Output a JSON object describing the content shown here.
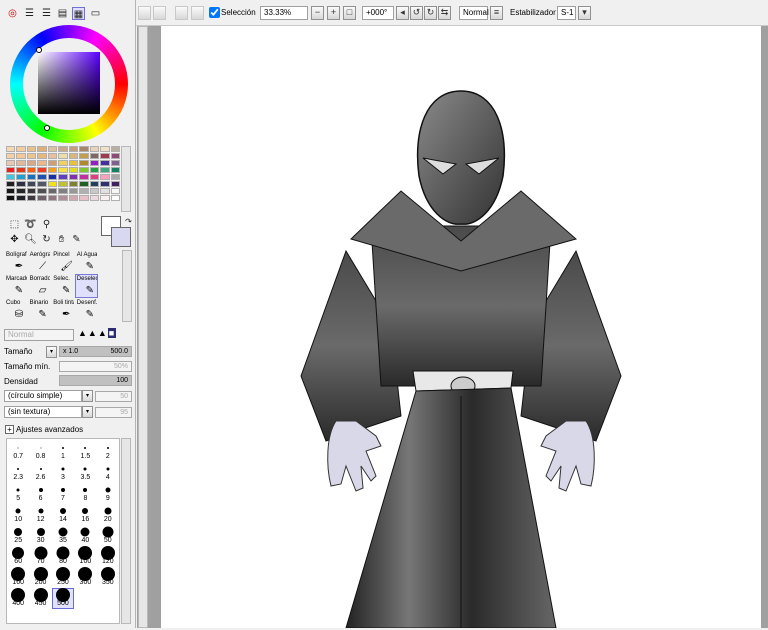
{
  "toolbar": {
    "selection_label": "Selección",
    "zoom": "33.33%",
    "rotation": "+000°",
    "blend_mode": "Normal",
    "stabilizer_label": "Estabilizador",
    "stabilizer_value": "S-1"
  },
  "color": {
    "hue_marker": "#5b00ff",
    "primary": "#ffffff",
    "secondary": "#d8d8f0"
  },
  "palette": [
    "#f6d8b4",
    "#f0cca0",
    "#e8c08c",
    "#dcb078",
    "#d8c0a0",
    "#c8a888",
    "#c0a080",
    "#a88868",
    "#e8d4b8",
    "#f0e0c8",
    "#b8b0a0",
    "#f4d0a8",
    "#f4c898",
    "#ecc48c",
    "#e4b880",
    "#e8c0a0",
    "#e8e0a8",
    "#d8b878",
    "#c0a050",
    "#806860",
    "#a03850",
    "#904878",
    "#e8c8b0",
    "#e0b8a0",
    "#d8a888",
    "#e8b890",
    "#d0a070",
    "#f0d060",
    "#e8c040",
    "#b08830",
    "#9020c0",
    "#4030a0",
    "#806090",
    "#e82020",
    "#e03818",
    "#f86010",
    "#e84028",
    "#f4a020",
    "#f8e040",
    "#e0e020",
    "#80c830",
    "#20a040",
    "#40a880",
    "#108060",
    "#40c8e0",
    "#20a0d0",
    "#1870c0",
    "#2050b0",
    "#1830a0",
    "#6040c0",
    "#8030b0",
    "#c030a0",
    "#e04080",
    "#f8a0c0",
    "#a8a8a8",
    "#202020",
    "#303040",
    "#404858",
    "#505868",
    "#f0e020",
    "#c0c030",
    "#808030",
    "#206020",
    "#204060",
    "#303070",
    "#402060",
    "#181818",
    "#282828",
    "#383838",
    "#505050",
    "#686868",
    "#808080",
    "#989898",
    "#b0b0b0",
    "#c8c8c8",
    "#e0e0e0",
    "#f8f8f8",
    "#101010",
    "#202028",
    "#403840",
    "#706068",
    "#907880",
    "#b09098",
    "#d0a8b0",
    "#e8c0c8",
    "#f0d8e0",
    "#f8f0f0",
    "#ffffff"
  ],
  "brushes": [
    {
      "label": "Bolígrafo",
      "icon": "pen-icon"
    },
    {
      "label": "Aerógrafo",
      "icon": "airbrush-icon"
    },
    {
      "label": "Pincel",
      "icon": "brush-icon"
    },
    {
      "label": "Al Agua",
      "icon": "water-brush-icon"
    },
    {
      "label": "",
      "icon": ""
    },
    {
      "label": "Marcador",
      "icon": "marker-icon"
    },
    {
      "label": "Borrador",
      "icon": "eraser-icon"
    },
    {
      "label": "Selec.",
      "icon": "select-pen-icon"
    },
    {
      "label": "Deselec.",
      "icon": "deselect-pen-icon"
    },
    {
      "label": "",
      "icon": ""
    },
    {
      "label": "Cubo",
      "icon": "bucket-icon"
    },
    {
      "label": "Binario",
      "icon": "binary-icon"
    },
    {
      "label": "Boli tinta",
      "icon": "ink-pen-icon"
    },
    {
      "label": "Desenf.",
      "icon": "blur-icon"
    },
    {
      "label": "",
      "icon": ""
    }
  ],
  "brush_props": {
    "blend": "Normal",
    "size_label": "Tamaño",
    "size_multiplier": "x 1.0",
    "size_value": "500.0",
    "min_size_label": "Tamaño mín.",
    "min_size_value": "50%",
    "density_label": "Densidad",
    "density_value": "100",
    "shape": "(círculo simple)",
    "shape_value": "50",
    "texture": "(sin textura)",
    "texture_value": "95",
    "advanced_label": "Ajustes avanzados"
  },
  "sizes": [
    "0.7",
    "0.8",
    "1",
    "1.5",
    "2",
    "2.3",
    "2.6",
    "3",
    "3.5",
    "4",
    "5",
    "6",
    "7",
    "8",
    "9",
    "10",
    "12",
    "14",
    "16",
    "20",
    "25",
    "30",
    "35",
    "40",
    "50",
    "60",
    "70",
    "80",
    "100",
    "120",
    "160",
    "200",
    "250",
    "300",
    "350",
    "400",
    "450",
    "500"
  ],
  "selected_size": "500"
}
